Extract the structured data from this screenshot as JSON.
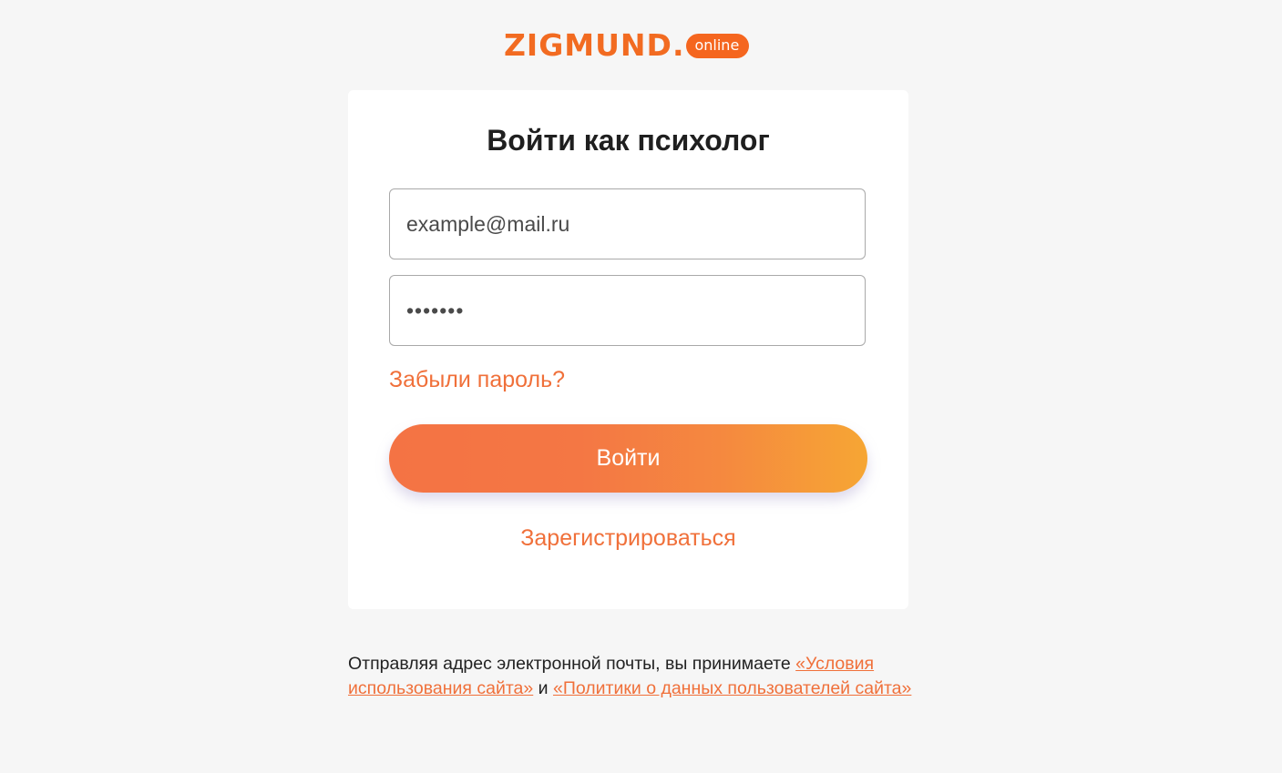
{
  "logo": {
    "wordmark": "ZIGMUND.",
    "badge": "online",
    "brand_color": "#f26b21"
  },
  "login_form": {
    "title": "Войти как психолог",
    "email": {
      "value": "example@mail.ru"
    },
    "password": {
      "masked_value": "•••••••"
    },
    "forgot_password_label": "Забыли пароль?",
    "submit_label": "Войти",
    "register_label": "Зарегистрироваться"
  },
  "terms": {
    "prefix": "Отправляя адрес электронной почты, вы принимаете ",
    "terms_link": "«Условия использования сайта»",
    "conjunction": " и ",
    "policy_link": "«Политики о данных пользователей сайта»"
  },
  "colors": {
    "accent": "#f0703a",
    "button_gradient_start": "#f47344",
    "button_gradient_end": "#f6a634",
    "background": "#f6f6f6"
  }
}
